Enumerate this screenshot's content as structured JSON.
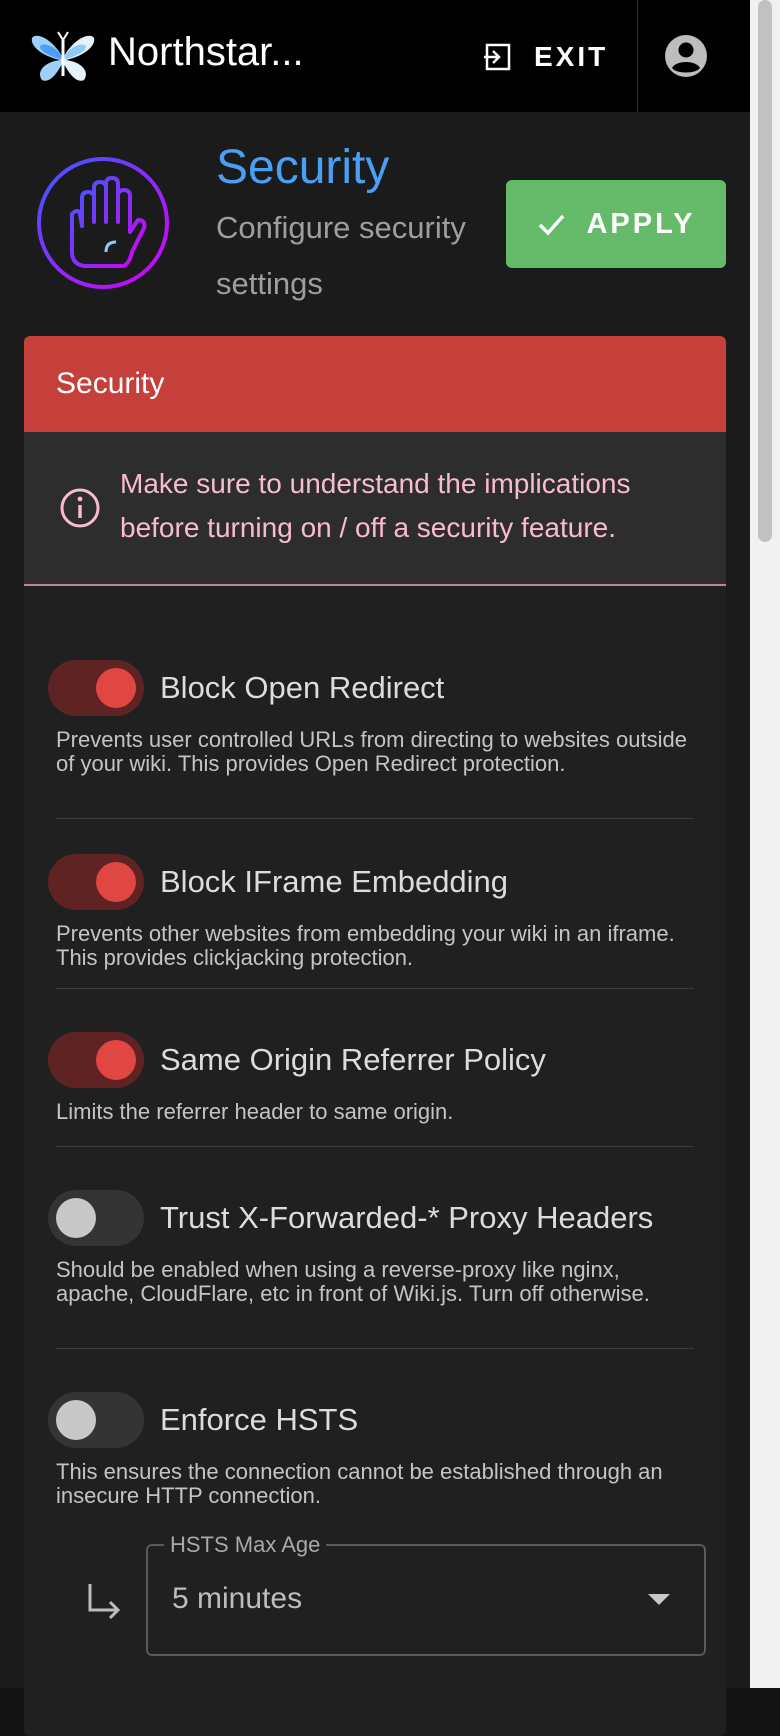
{
  "appbar": {
    "title": "Northstar...",
    "exit_label": "EXIT"
  },
  "page": {
    "title": "Security",
    "subtitle": "Configure security settings",
    "apply_label": "APPLY"
  },
  "card": {
    "header": "Security",
    "alert": "Make sure to understand the implications before turning on / off a security feature."
  },
  "settings": [
    {
      "label": "Block Open Redirect",
      "description": "Prevents user controlled URLs from directing to websites outside of your wiki. This provides Open Redirect protection.",
      "enabled": true
    },
    {
      "label": "Block IFrame Embedding",
      "description": "Prevents other websites from embedding your wiki in an iframe. This provides clickjacking protection.",
      "enabled": true
    },
    {
      "label": "Same Origin Referrer Policy",
      "description": "Limits the referrer header to same origin.",
      "enabled": true
    },
    {
      "label": "Trust X-Forwarded-* Proxy Headers",
      "description": "Should be enabled when using a reverse-proxy like nginx, apache, CloudFlare, etc in front of Wiki.js. Turn off otherwise.",
      "enabled": false
    },
    {
      "label": "Enforce HSTS",
      "description": "This ensures the connection cannot be established through an insecure HTTP connection.",
      "enabled": false
    }
  ],
  "hsts": {
    "label": "HSTS Max Age",
    "value": "5 minutes"
  },
  "colors": {
    "accent_blue": "#4a9ff5",
    "apply_green": "#66bb6a",
    "header_red": "#c6403b",
    "switch_on": "#e04642"
  }
}
